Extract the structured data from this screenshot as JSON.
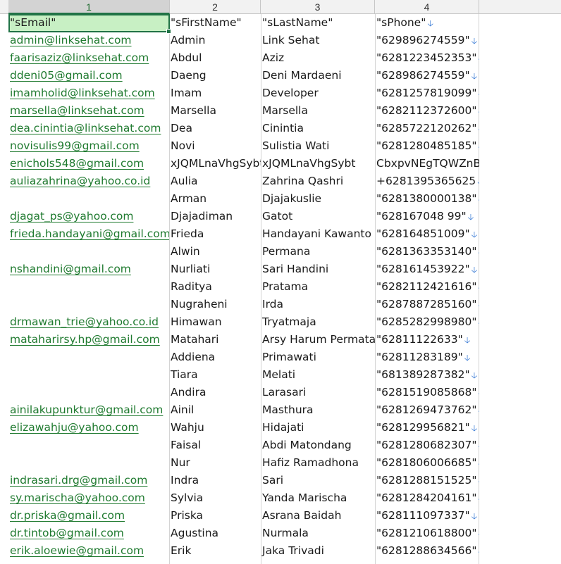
{
  "columns": [
    "1",
    "2",
    "3",
    "4"
  ],
  "header_row": {
    "email": "\"sEmail\"",
    "first": "\"sFirstName\"",
    "last": "\"sLastName\"",
    "phone": "\"sPhone\""
  },
  "rows": [
    {
      "email": "admin@linksehat.com",
      "first": "Admin",
      "last": "Link Sehat",
      "phone": "\"629896274559\""
    },
    {
      "email": "faarisaziz@linksehat.com",
      "first": "Abdul",
      "last": "Aziz",
      "phone": "\"6281223452353\""
    },
    {
      "email": "ddeni05@gmail.com",
      "first": "Daeng",
      "last": "Deni Mardaeni",
      "phone": "\"628986274559\""
    },
    {
      "email": "imamholid@linksehat.com",
      "first": "Imam",
      "last": "Developer",
      "phone": "\"6281257819099\""
    },
    {
      "email": "marsella@linksehat.com",
      "first": "Marsella",
      "last": "Marsella",
      "phone": "\"6282112372600\""
    },
    {
      "email": "dea.cinintia@linksehat.com",
      "first": "Dea",
      "last": "Cinintia",
      "phone": "\"6285722120262\""
    },
    {
      "email": "novisulis99@gmail.com",
      "first": "Novi",
      "last": "Sulistia Wati",
      "phone": "\"6281280485185\""
    },
    {
      "email": "enichols548@gmail.com",
      "first": "xJQMLnaVhgSybt",
      "last": "xJQMLnaVhgSybt",
      "phone": "CbxpvNEgTQWZnB"
    },
    {
      "email": "auliazahrina@yahoo.co.id",
      "first": "Aulia",
      "last": "Zahrina Qashri",
      "phone": "+6281395365625"
    },
    {
      "email": "",
      "first": "Arman",
      "last": "Djajakuslie",
      "phone": "\"6281380000138\""
    },
    {
      "email": "djagat_ps@yahoo.com",
      "first": "Djajadiman",
      "last": "Gatot",
      "phone": "\"628167048 99\""
    },
    {
      "email": "frieda.handayani@gmail.com",
      "first": "Frieda",
      "last": "Handayani Kawanto",
      "phone": "\"628164851009\""
    },
    {
      "email": "",
      "first": "Alwin",
      "last": "Permana",
      "phone": "\"6281363353140\""
    },
    {
      "email": "nshandini@gmail.com",
      "first": "Nurliati",
      "last": "Sari Handini",
      "phone": "\"628161453922\""
    },
    {
      "email": "",
      "first": "Raditya",
      "last": "Pratama",
      "phone": "\"6282112421616\""
    },
    {
      "email": "",
      "first": "Nugraheni",
      "last": "Irda",
      "phone": "\"6287887285160\""
    },
    {
      "email": "drmawan_trie@yahoo.co.id",
      "first": "Himawan",
      "last": "Tryatmaja",
      "phone": "\"6285282998980\""
    },
    {
      "email": "mataharirsy.hp@gmail.com",
      "first": "Matahari",
      "last": "Arsy Harum Permata",
      "phone": "\"62811122633\""
    },
    {
      "email": "",
      "first": "Addiena",
      "last": "Primawati",
      "phone": "\"62811283189\""
    },
    {
      "email": "",
      "first": "Tiara",
      "last": "Melati",
      "phone": "\"681389287382\""
    },
    {
      "email": "",
      "first": "Andira",
      "last": "Larasari",
      "phone": "\"6281519085868\""
    },
    {
      "email": "ainilakupunktur@gmail.com",
      "first": "Ainil",
      "last": "Masthura",
      "phone": "\"6281269473762\""
    },
    {
      "email": "elizawahju@yahoo.com",
      "first": "Wahju",
      "last": "Hidajati",
      "phone": "\"628129956821\""
    },
    {
      "email": "",
      "first": "Faisal",
      "last": "Abdi Matondang",
      "phone": "\"6281280682307\""
    },
    {
      "email": "",
      "first": "Nur",
      "last": "Hafiz Ramadhona",
      "phone": "\"6281806006685\""
    },
    {
      "email": "indrasari.drg@gmail.com",
      "first": "Indra",
      "last": "Sari",
      "phone": "\"6281288151525\""
    },
    {
      "email": "sy.marischa@yahoo.com",
      "first": "Sylvia",
      "last": "Yanda Marischa",
      "phone": "\"6281284204161\""
    },
    {
      "email": "dr.priska@gmail.com",
      "first": "Priska",
      "last": "Asrana Baidah",
      "phone": "\"628111097337\""
    },
    {
      "email": "dr.tintob@gmail.com",
      "first": "Agustina",
      "last": "Nurmala",
      "phone": "\"6281210618800\""
    },
    {
      "email": "erik.aloewie@gmail.com",
      "first": "Erik",
      "last": "Jaka Trivadi",
      "phone": "\"6281288634566\""
    }
  ],
  "arrow_icon": "down-arrow-icon",
  "colors": {
    "link": "#1f7a2f",
    "selection_fill": "#c8f0c4",
    "selection_border": "#217346",
    "arrow": "#3a7bd5"
  }
}
